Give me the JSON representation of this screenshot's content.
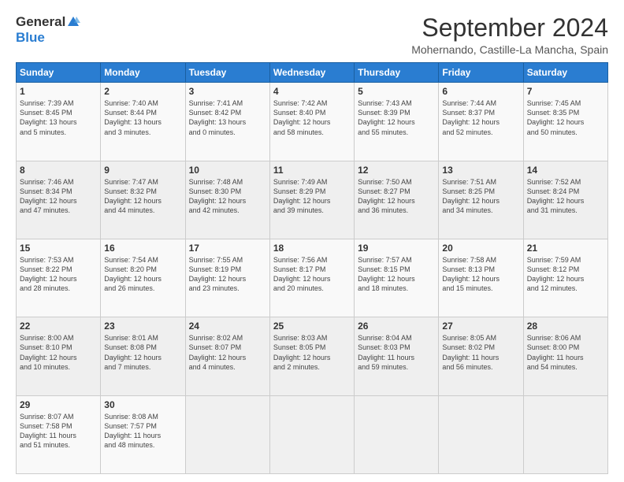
{
  "logo": {
    "general": "General",
    "blue": "Blue"
  },
  "header": {
    "title": "September 2024",
    "subtitle": "Mohernando, Castille-La Mancha, Spain"
  },
  "days_of_week": [
    "Sunday",
    "Monday",
    "Tuesday",
    "Wednesday",
    "Thursday",
    "Friday",
    "Saturday"
  ],
  "weeks": [
    [
      {
        "day": "1",
        "info": "Sunrise: 7:39 AM\nSunset: 8:45 PM\nDaylight: 13 hours\nand 5 minutes."
      },
      {
        "day": "2",
        "info": "Sunrise: 7:40 AM\nSunset: 8:44 PM\nDaylight: 13 hours\nand 3 minutes."
      },
      {
        "day": "3",
        "info": "Sunrise: 7:41 AM\nSunset: 8:42 PM\nDaylight: 13 hours\nand 0 minutes."
      },
      {
        "day": "4",
        "info": "Sunrise: 7:42 AM\nSunset: 8:40 PM\nDaylight: 12 hours\nand 58 minutes."
      },
      {
        "day": "5",
        "info": "Sunrise: 7:43 AM\nSunset: 8:39 PM\nDaylight: 12 hours\nand 55 minutes."
      },
      {
        "day": "6",
        "info": "Sunrise: 7:44 AM\nSunset: 8:37 PM\nDaylight: 12 hours\nand 52 minutes."
      },
      {
        "day": "7",
        "info": "Sunrise: 7:45 AM\nSunset: 8:35 PM\nDaylight: 12 hours\nand 50 minutes."
      }
    ],
    [
      {
        "day": "8",
        "info": "Sunrise: 7:46 AM\nSunset: 8:34 PM\nDaylight: 12 hours\nand 47 minutes."
      },
      {
        "day": "9",
        "info": "Sunrise: 7:47 AM\nSunset: 8:32 PM\nDaylight: 12 hours\nand 44 minutes."
      },
      {
        "day": "10",
        "info": "Sunrise: 7:48 AM\nSunset: 8:30 PM\nDaylight: 12 hours\nand 42 minutes."
      },
      {
        "day": "11",
        "info": "Sunrise: 7:49 AM\nSunset: 8:29 PM\nDaylight: 12 hours\nand 39 minutes."
      },
      {
        "day": "12",
        "info": "Sunrise: 7:50 AM\nSunset: 8:27 PM\nDaylight: 12 hours\nand 36 minutes."
      },
      {
        "day": "13",
        "info": "Sunrise: 7:51 AM\nSunset: 8:25 PM\nDaylight: 12 hours\nand 34 minutes."
      },
      {
        "day": "14",
        "info": "Sunrise: 7:52 AM\nSunset: 8:24 PM\nDaylight: 12 hours\nand 31 minutes."
      }
    ],
    [
      {
        "day": "15",
        "info": "Sunrise: 7:53 AM\nSunset: 8:22 PM\nDaylight: 12 hours\nand 28 minutes."
      },
      {
        "day": "16",
        "info": "Sunrise: 7:54 AM\nSunset: 8:20 PM\nDaylight: 12 hours\nand 26 minutes."
      },
      {
        "day": "17",
        "info": "Sunrise: 7:55 AM\nSunset: 8:19 PM\nDaylight: 12 hours\nand 23 minutes."
      },
      {
        "day": "18",
        "info": "Sunrise: 7:56 AM\nSunset: 8:17 PM\nDaylight: 12 hours\nand 20 minutes."
      },
      {
        "day": "19",
        "info": "Sunrise: 7:57 AM\nSunset: 8:15 PM\nDaylight: 12 hours\nand 18 minutes."
      },
      {
        "day": "20",
        "info": "Sunrise: 7:58 AM\nSunset: 8:13 PM\nDaylight: 12 hours\nand 15 minutes."
      },
      {
        "day": "21",
        "info": "Sunrise: 7:59 AM\nSunset: 8:12 PM\nDaylight: 12 hours\nand 12 minutes."
      }
    ],
    [
      {
        "day": "22",
        "info": "Sunrise: 8:00 AM\nSunset: 8:10 PM\nDaylight: 12 hours\nand 10 minutes."
      },
      {
        "day": "23",
        "info": "Sunrise: 8:01 AM\nSunset: 8:08 PM\nDaylight: 12 hours\nand 7 minutes."
      },
      {
        "day": "24",
        "info": "Sunrise: 8:02 AM\nSunset: 8:07 PM\nDaylight: 12 hours\nand 4 minutes."
      },
      {
        "day": "25",
        "info": "Sunrise: 8:03 AM\nSunset: 8:05 PM\nDaylight: 12 hours\nand 2 minutes."
      },
      {
        "day": "26",
        "info": "Sunrise: 8:04 AM\nSunset: 8:03 PM\nDaylight: 11 hours\nand 59 minutes."
      },
      {
        "day": "27",
        "info": "Sunrise: 8:05 AM\nSunset: 8:02 PM\nDaylight: 11 hours\nand 56 minutes."
      },
      {
        "day": "28",
        "info": "Sunrise: 8:06 AM\nSunset: 8:00 PM\nDaylight: 11 hours\nand 54 minutes."
      }
    ],
    [
      {
        "day": "29",
        "info": "Sunrise: 8:07 AM\nSunset: 7:58 PM\nDaylight: 11 hours\nand 51 minutes."
      },
      {
        "day": "30",
        "info": "Sunrise: 8:08 AM\nSunset: 7:57 PM\nDaylight: 11 hours\nand 48 minutes."
      },
      null,
      null,
      null,
      null,
      null
    ]
  ]
}
